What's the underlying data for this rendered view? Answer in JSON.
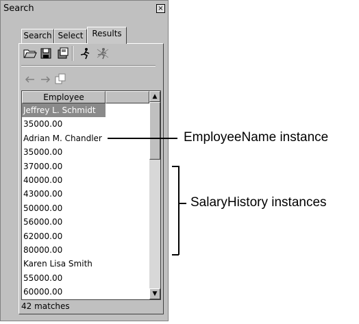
{
  "window": {
    "title": "Search",
    "close_glyph": "×"
  },
  "tabs": [
    {
      "label": "Search",
      "active": false
    },
    {
      "label": "Select",
      "active": false
    },
    {
      "label": "Results",
      "active": true
    }
  ],
  "toolbar": {
    "row1": [
      "open-folder-icon",
      "save-disk-icon",
      "save-all-icon",
      "run-icon",
      "run-all-icon"
    ],
    "row2": [
      "back-arrow-icon",
      "forward-arrow-icon",
      "copy-pages-icon"
    ]
  },
  "results": {
    "column_header": "Employee",
    "rows": [
      "Jeffrey L. Schmidt",
      "35000.00",
      "Adrian M. Chandler",
      "35000.00",
      "37000.00",
      "40000.00",
      "43000.00",
      "50000.00",
      "56000.00",
      "62000.00",
      "80000.00",
      "Karen Lisa Smith",
      "55000.00",
      "60000.00"
    ],
    "selected_index": 0,
    "status": "42 matches"
  },
  "annotations": {
    "employee_name": "EmployeeName instance",
    "salary_history": "SalaryHistory instances"
  },
  "colors": {
    "selection": "#8a8a8a",
    "panel": "#c0c0c0"
  }
}
